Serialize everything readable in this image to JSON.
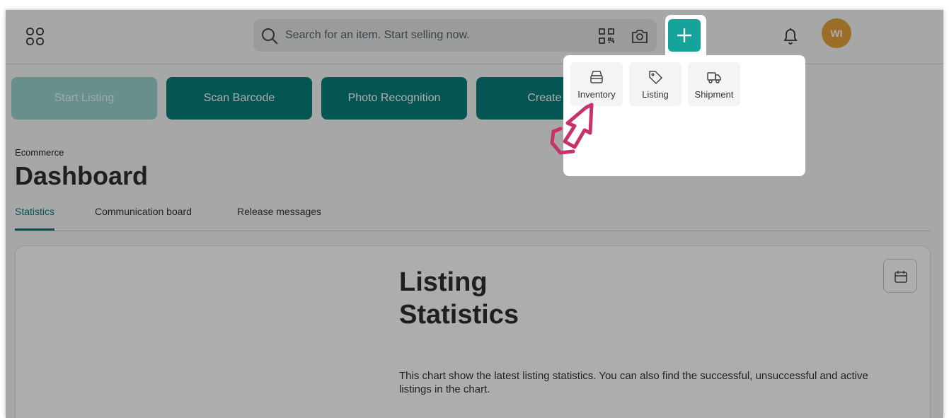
{
  "header": {
    "search_placeholder": "Search for an item. Start selling now.",
    "avatar_initials": "WI",
    "icons": [
      "apps-grid-icon",
      "search-icon",
      "qr-code-icon",
      "camera-icon",
      "plus-icon",
      "bell-icon"
    ]
  },
  "actions": [
    {
      "label": "Start Listing",
      "active": true
    },
    {
      "label": "Scan Barcode"
    },
    {
      "label": "Photo Recognition"
    },
    {
      "label": "Create It"
    }
  ],
  "page": {
    "breadcrumb": "Ecommerce",
    "title": "Dashboard"
  },
  "tabs": [
    {
      "label": "Statistics",
      "active": true
    },
    {
      "label": "Communication board"
    },
    {
      "label": "Release messages"
    }
  ],
  "card": {
    "title_line1": "Listing",
    "title_line2": "Statistics",
    "description": "This chart show the latest listing statistics. You can also find the successful, unsuccessful and active listings in the chart."
  },
  "menu": {
    "items": [
      {
        "label": "Inventory",
        "icon": "inventory-box-icon"
      },
      {
        "label": "Listing",
        "icon": "tag-icon"
      },
      {
        "label": "Shipment",
        "icon": "truck-icon"
      }
    ]
  },
  "colors": {
    "primary": "#087e7a",
    "plus_button": "#16a39b",
    "avatar": "#e3a33c",
    "pointer": "#c8326a"
  }
}
